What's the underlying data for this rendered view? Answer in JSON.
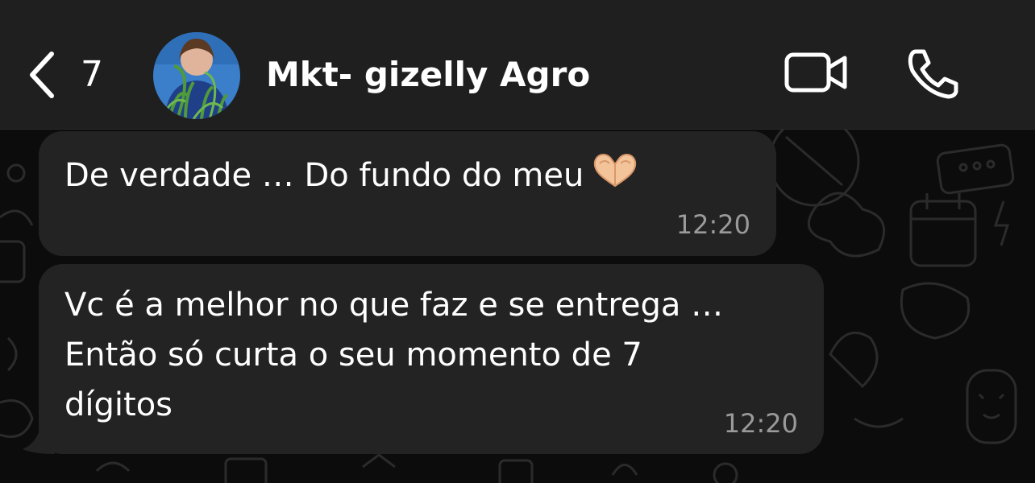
{
  "header": {
    "unread_count": "7",
    "contact_name": "Mkt- gizelly Agro",
    "icons": {
      "back": "chevron-left-icon",
      "video": "video-camera-icon",
      "phone": "phone-icon"
    }
  },
  "messages": [
    {
      "lines": [
        "De verdade … Do fundo do meu"
      ],
      "emoji": "heart-hands-emoji",
      "time": "12:20"
    },
    {
      "lines": [
        "Vc é a melhor no que faz e se entrega …",
        "Então só curta o seu momento de 7",
        "dígitos"
      ],
      "time": "12:20"
    }
  ],
  "colors": {
    "header_bg": "#1f1f1f",
    "bubble_bg": "#232323",
    "text": "#ffffff",
    "time_text": "#9a9a9a",
    "wallpaper_bg": "#0c0c0c"
  }
}
